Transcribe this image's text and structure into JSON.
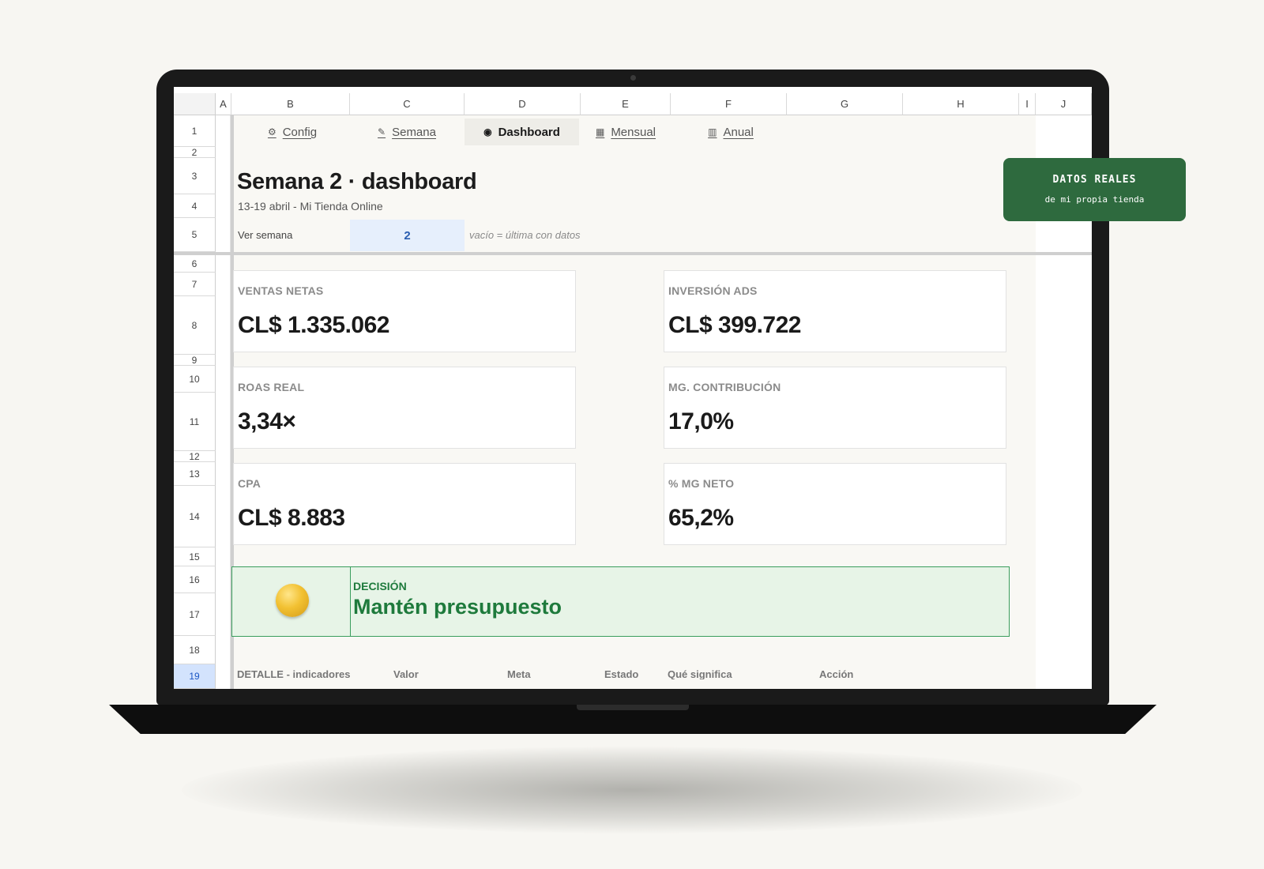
{
  "columns": [
    "A",
    "B",
    "C",
    "D",
    "E",
    "F",
    "G",
    "H",
    "I",
    "J"
  ],
  "rows": [
    "1",
    "2",
    "3",
    "4",
    "5",
    "6",
    "7",
    "8",
    "9",
    "10",
    "11",
    "12",
    "13",
    "14",
    "15",
    "16",
    "17",
    "18",
    "19"
  ],
  "selected_row": "19",
  "tabs": [
    {
      "label": "Config",
      "icon": "gear-icon",
      "glyph": "⚙"
    },
    {
      "label": "Semana",
      "icon": "pencil-icon",
      "glyph": "✎"
    },
    {
      "label": "Dashboard",
      "icon": "dashboard-icon",
      "glyph": "◉",
      "active": true
    },
    {
      "label": "Mensual",
      "icon": "calendar-grid-icon",
      "glyph": "▦"
    },
    {
      "label": "Anual",
      "icon": "calendar-grid-icon",
      "glyph": "▥"
    }
  ],
  "header": {
    "title": "Semana 2 · dashboard",
    "subtitle": "13-19 abril - Mi Tienda Online",
    "week_label": "Ver semana",
    "week_value": "2",
    "week_hint": "vacío = última con datos"
  },
  "kpis": [
    {
      "label": "VENTAS NETAS",
      "value": "CL$ 1.335.062"
    },
    {
      "label": "INVERSIÓN ADS",
      "value": "CL$ 399.722"
    },
    {
      "label": "ROAS REAL",
      "value": "3,34×"
    },
    {
      "label": "MG. CONTRIBUCIÓN",
      "value": "17,0%"
    },
    {
      "label": "CPA",
      "value": "CL$ 8.883"
    },
    {
      "label": "% MG NETO",
      "value": "65,2%"
    }
  ],
  "decision": {
    "label": "DECISIÓN",
    "value": "Mantén presupuesto",
    "status_color": "#f2c132"
  },
  "detail_headers": [
    "DETALLE - indicadores",
    "Valor",
    "Meta",
    "Estado",
    "Qué significa",
    "Acción"
  ],
  "badge": {
    "title": "DATOS REALES",
    "subtitle": "de mi propia tienda"
  },
  "colors": {
    "accent_green": "#2e6a3e",
    "decision_green": "#1e7a3c",
    "input_blue": "#2a5db0"
  }
}
